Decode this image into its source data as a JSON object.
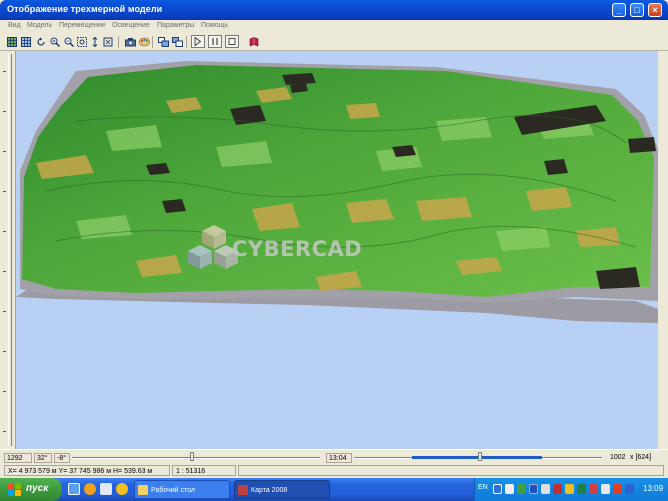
{
  "window": {
    "title": "Отображение трехмерной модели",
    "minimize_glyph": "_",
    "maximize_glyph": "□",
    "close_glyph": "×"
  },
  "menu": [
    {
      "id": "view",
      "label": "Вид"
    },
    {
      "id": "model",
      "label": "Модель"
    },
    {
      "id": "move",
      "label": "Перемещение"
    },
    {
      "id": "lighting",
      "label": "Освещение"
    },
    {
      "id": "params",
      "label": "Параметры"
    },
    {
      "id": "help",
      "label": "Помощь"
    }
  ],
  "toolbar": {
    "icons": [
      "grid-icon",
      "grid-alt-icon",
      "rotate-icon",
      "zoom-in-icon",
      "zoom-out-icon",
      "zoom-window-icon",
      "fit-vertical-icon",
      "fit-icon",
      "camera-icon",
      "palette-icon",
      "layers-icon",
      "layers-alt-icon",
      "pointer-icon",
      "pause-icon",
      "stop-icon",
      "book-icon"
    ]
  },
  "watermark": {
    "text": "CYBERCAD"
  },
  "status": {
    "tilt": "1292",
    "angle": "32°",
    "rotation": "-8°",
    "time": "13:04",
    "size": "1002",
    "size_unit": "x [624]",
    "coords": "X= 4 973 579 м  Y= 37 745 986 м  H= 539.63 м",
    "scale": "1 : 51316"
  },
  "taskbar": {
    "start_label": "пуск",
    "tasks": [
      {
        "label": "Рабочий стол",
        "state": "inactive"
      },
      {
        "label": "Карта 2008",
        "state": "active"
      }
    ],
    "language": "EN",
    "clock": "13:09"
  },
  "colors": {
    "sky": "#b8d0f4",
    "terrain_green": "#4fa83a",
    "terrain_yellow": "#c8a64a",
    "terrain_dark": "#2b2a22",
    "titlebar": "#0b4ad0",
    "taskbar": "#245edb"
  }
}
